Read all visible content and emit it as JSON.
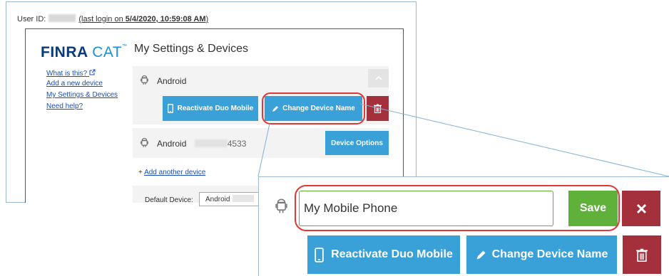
{
  "header": {
    "user_id_label": "User ID:",
    "last_login_prefix": "(last login on ",
    "last_login_value": "5/4/2020, 10:59:08 AM",
    "last_login_suffix": ")"
  },
  "logo": {
    "finra": "FINRA",
    "cat": "CAT",
    "tm": "™"
  },
  "sidebar": {
    "items": [
      {
        "label": "What is this?"
      },
      {
        "label": "Add a new device"
      },
      {
        "label": "My Settings & Devices"
      },
      {
        "label": "Need help?"
      }
    ]
  },
  "main": {
    "title": "My Settings & Devices",
    "devices": [
      {
        "name": "Android"
      },
      {
        "name": "Android",
        "suffix": "4533"
      }
    ],
    "buttons": {
      "reactivate": "Reactivate Duo Mobile",
      "change_name": "Change Device Name",
      "device_options": "Device Options"
    },
    "add_prefix": "+ ",
    "add_another": "Add another device",
    "default_device_label": "Default Device:",
    "default_device_value": "Android"
  },
  "zoom": {
    "name_input_value": "My Mobile Phone",
    "save": "Save",
    "reactivate": "Reactivate Duo Mobile",
    "change_name": "Change Device Name"
  },
  "colors": {
    "blue_button": "#3aa0d8",
    "red_button": "#a4303b",
    "green_button": "#5fb13a",
    "highlight": "#e03838",
    "link": "#1a4fb4"
  }
}
